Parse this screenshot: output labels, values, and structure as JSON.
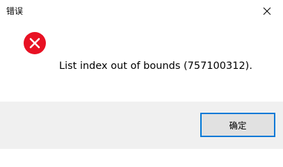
{
  "window": {
    "title": "错误",
    "close_icon": "close-icon"
  },
  "message": {
    "icon": "error-icon",
    "text": "List index out of bounds (757100312)."
  },
  "buttons": {
    "ok_label": "确定"
  },
  "colors": {
    "error_red": "#e81123",
    "accent_blue": "#0078d7",
    "footer_bg": "#f0f0f0",
    "button_bg": "#e1e1e1"
  }
}
